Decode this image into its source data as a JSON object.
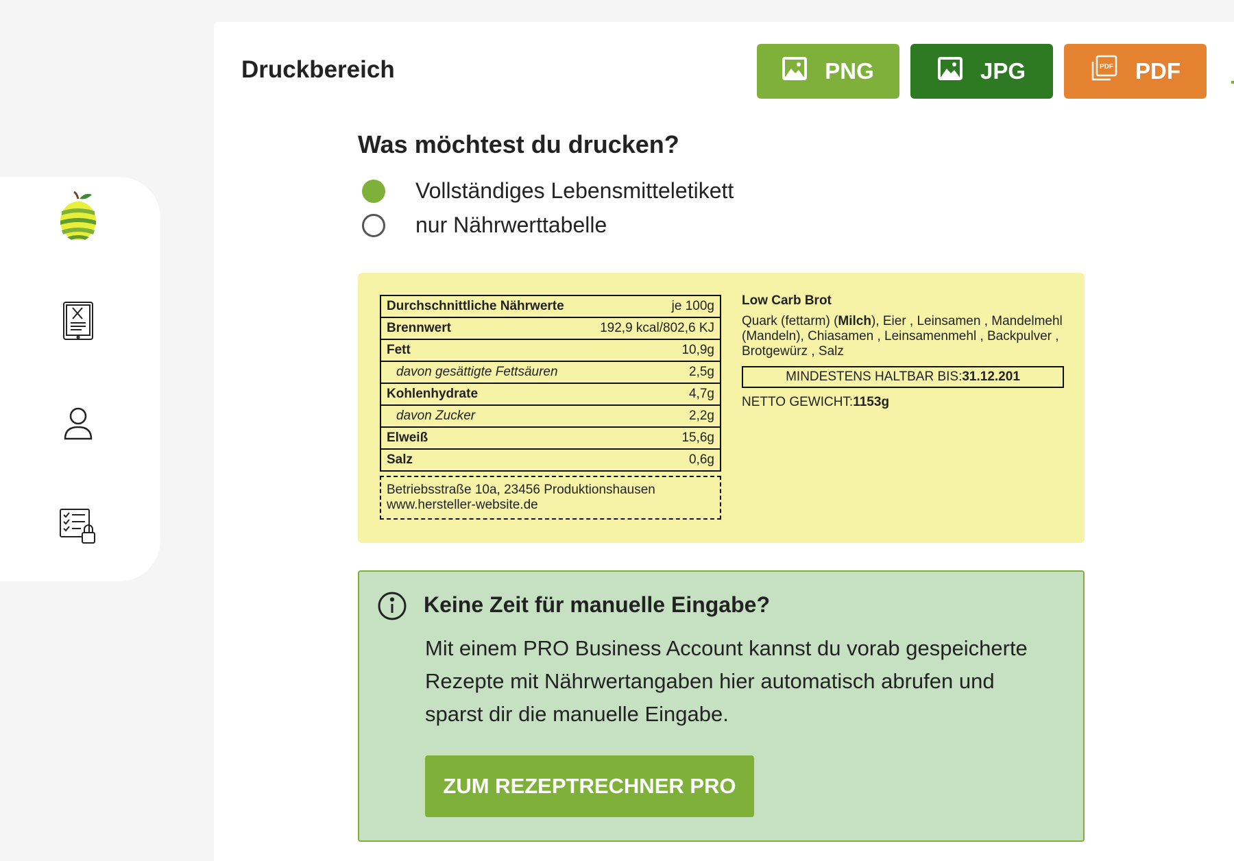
{
  "sidebar": {
    "icons": [
      "apple-logo-icon",
      "recipe-tablet-icon",
      "user-icon",
      "checklist-lock-icon"
    ]
  },
  "header": {
    "title": "Druckbereich",
    "export_buttons": [
      {
        "label": "PNG",
        "icon": "image-icon",
        "color": "#7fb13a"
      },
      {
        "label": "JPG",
        "icon": "image-icon",
        "color": "#2e7a23"
      },
      {
        "label": "PDF",
        "icon": "pdf-icon",
        "color": "#e5822f"
      }
    ]
  },
  "print_options": {
    "question": "Was möchtest du drucken?",
    "options": [
      {
        "label": "Vollständiges Lebensmitteletikett",
        "selected": true
      },
      {
        "label": "nur Nährwerttabelle",
        "selected": false
      }
    ]
  },
  "label_preview": {
    "nutrition": {
      "header": {
        "label": "Durchschnittliche Nährwerte",
        "value": "je 100g"
      },
      "rows": [
        {
          "label": "Brennwert",
          "value": "192,9 kcal/802,6 KJ",
          "sub": false
        },
        {
          "label": "Fett",
          "value": "10,9g",
          "sub": false
        },
        {
          "label": "davon gesättigte Fettsäuren",
          "value": "2,5g",
          "sub": true
        },
        {
          "label": "Kohlenhydrate",
          "value": "4,7g",
          "sub": false
        },
        {
          "label": "davon Zucker",
          "value": "2,2g",
          "sub": true
        },
        {
          "label": "Elweiß",
          "value": "15,6g",
          "sub": false
        },
        {
          "label": "Salz",
          "value": "0,6g",
          "sub": false
        }
      ]
    },
    "address": {
      "line1": "Betriebsstraße 10a, 23456 Produktionshausen",
      "line2": "www.hersteller-website.de"
    },
    "product": {
      "name": "Low Carb Brot",
      "ingredients_pre": "Quark (fettarm) (",
      "ingredients_bold": "Milch",
      "ingredients_post": "), Eier , Leinsamen , Mandelmehl (Mandeln), Chiasamen , Leinsamenmehl , Backpulver , Brotgewürz , Salz",
      "mhd_label": "MINDESTENS HALTBAR BIS: ",
      "mhd_value": "31.12.201",
      "netto_label": "NETTO GEWICHT:",
      "netto_value": "1153g"
    }
  },
  "pro_box": {
    "title": "Keine Zeit für manuelle Eingabe?",
    "text": "Mit einem PRO Business Account kannst du vorab gespeicherte Rezepte mit Nährwertangaben hier automatisch abrufen und sparst dir die manuelle Eingabe.",
    "button": "ZUM REZEPTRECHNER PRO"
  }
}
